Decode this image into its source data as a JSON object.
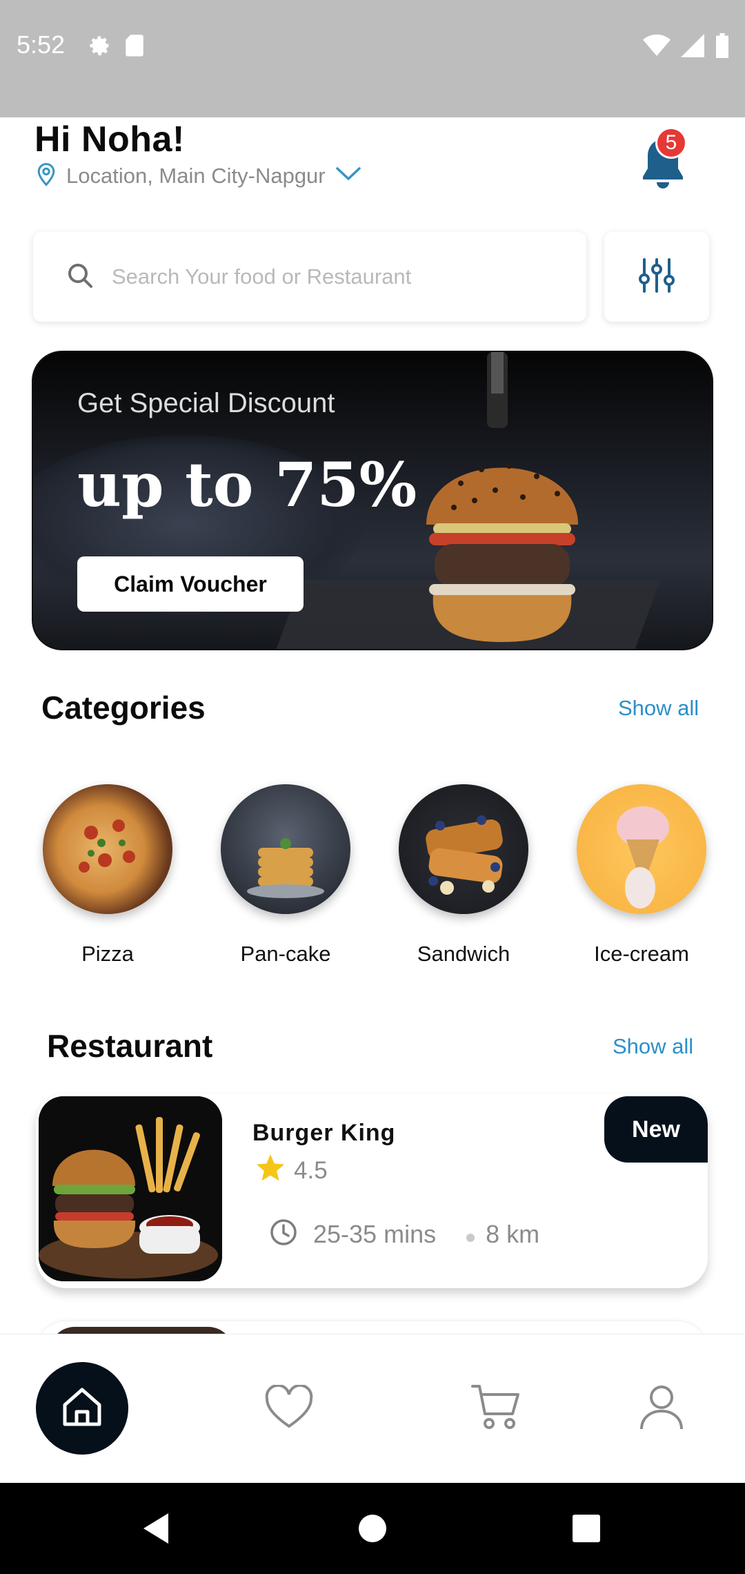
{
  "status_bar": {
    "time": "5:52",
    "icons": [
      "settings-icon",
      "sd-card-icon",
      "wifi-icon",
      "signal-icon",
      "battery-icon"
    ]
  },
  "header": {
    "greeting": "Hi Noha!",
    "location": "Location, Main City-Napgur",
    "notification_count": "5"
  },
  "search": {
    "placeholder": "Search Your food or Restaurant"
  },
  "banner": {
    "subtitle": "Get Special Discount",
    "headline": "up to 75%",
    "button_label": "Claim Voucher"
  },
  "categories": {
    "title": "Categories",
    "show_all": "Show all",
    "items": [
      {
        "label": "Pizza"
      },
      {
        "label": "Pan-cake"
      },
      {
        "label": "Sandwich"
      },
      {
        "label": "Ice-cream"
      }
    ]
  },
  "restaurants": {
    "title": "Restaurant",
    "show_all": "Show all",
    "items": [
      {
        "name": "Burger King",
        "rating": "4.5",
        "time": "25-35 mins",
        "distance": "8 km",
        "badge": "New"
      }
    ]
  },
  "bottom_nav": {
    "items": [
      "home-icon",
      "heart-icon",
      "cart-icon",
      "profile-icon"
    ],
    "active": "home-icon"
  },
  "colors": {
    "accent_dark": "#06101a",
    "link_blue": "#2b8fc9",
    "bell_blue": "#1f5f8b",
    "badge_red": "#e53935",
    "star_yellow": "#f5c518"
  }
}
